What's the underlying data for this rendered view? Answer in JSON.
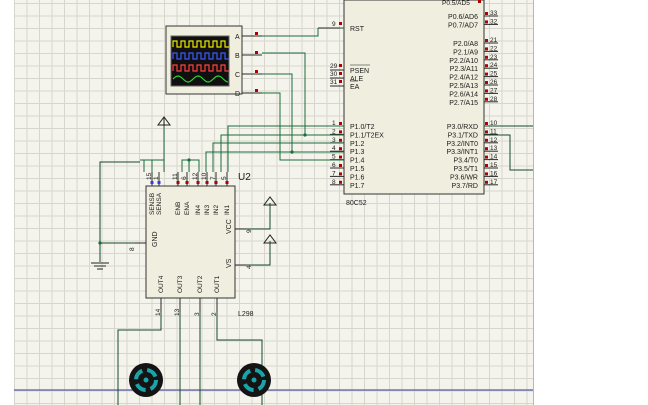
{
  "mcu": {
    "name": "80C52",
    "rst_label": "RST",
    "rst_num": "9",
    "left_pins": [
      {
        "num": "29",
        "label": "PSEN"
      },
      {
        "num": "30",
        "label": "ALE"
      },
      {
        "num": "31",
        "label": "EA"
      }
    ],
    "p1_pins": [
      {
        "num": "1",
        "label": "P1.0/T2"
      },
      {
        "num": "2",
        "label": "P1.1/T2EX"
      },
      {
        "num": "3",
        "label": "P1.2"
      },
      {
        "num": "4",
        "label": "P1.3"
      },
      {
        "num": "5",
        "label": "P1.4"
      },
      {
        "num": "6",
        "label": "P1.5"
      },
      {
        "num": "7",
        "label": "P1.6"
      },
      {
        "num": "8",
        "label": "P1.7"
      }
    ],
    "p0_pins": [
      {
        "num": "33",
        "label": "P0.6/AD6"
      },
      {
        "num": "32",
        "label": "P0.7/AD7"
      }
    ],
    "p2_pins": [
      {
        "num": "21",
        "label": "P2.0/A8"
      },
      {
        "num": "22",
        "label": "P2.1/A9"
      },
      {
        "num": "23",
        "label": "P2.2/A10"
      },
      {
        "num": "24",
        "label": "P2.3/A11"
      },
      {
        "num": "25",
        "label": "P2.4/A12"
      },
      {
        "num": "26",
        "label": "P2.5/A13"
      },
      {
        "num": "27",
        "label": "P2.6/A14"
      },
      {
        "num": "28",
        "label": "P2.7/A15"
      }
    ],
    "p3_pins": [
      {
        "num": "10",
        "label": "P3.0/RXD"
      },
      {
        "num": "11",
        "label": "P3.1/TXD"
      },
      {
        "num": "12",
        "label": "P3.2/INT0"
      },
      {
        "num": "13",
        "label": "P3.3/INT1"
      },
      {
        "num": "14",
        "label": "P3.4/T0"
      },
      {
        "num": "15",
        "label": "P3.5/T1"
      },
      {
        "num": "16",
        "label": "P3.6/WR"
      },
      {
        "num": "17",
        "label": "P3.7/RD"
      }
    ]
  },
  "scope": {
    "channels": [
      "A",
      "B",
      "C",
      "D"
    ],
    "trace_colors": [
      "#e8e800",
      "#3b5bff",
      "#ff4040",
      "#30d030"
    ]
  },
  "driver": {
    "ref": "U2",
    "part": "L298",
    "top_pins": [
      {
        "num": "15",
        "label": "SENSB"
      },
      {
        "num": "1",
        "label": "SENSA"
      },
      {
        "num": "11",
        "label": "ENB"
      },
      {
        "num": "6",
        "label": "ENA"
      },
      {
        "num": "12",
        "label": "IN4"
      },
      {
        "num": "10",
        "label": "IN3"
      },
      {
        "num": "7",
        "label": "IN2"
      },
      {
        "num": "5",
        "label": "IN1"
      }
    ],
    "gnd": {
      "num": "8",
      "label": "GND"
    },
    "vcc": {
      "num": "9",
      "label": "VCC"
    },
    "vs": {
      "num": "4",
      "label": "VS"
    },
    "bottom_pins": [
      {
        "num": "14",
        "label": "OUT4"
      },
      {
        "num": "13",
        "label": "OUT3"
      },
      {
        "num": "3",
        "label": "OUT2"
      },
      {
        "num": "2",
        "label": "OUT1"
      }
    ]
  },
  "colors": {
    "sheet": "#f4f4ec",
    "wire": "#1c6b3e",
    "chip_body": "#f0eedf",
    "scope_screen": "#101010",
    "motor_teal": "#1aa3a8"
  }
}
